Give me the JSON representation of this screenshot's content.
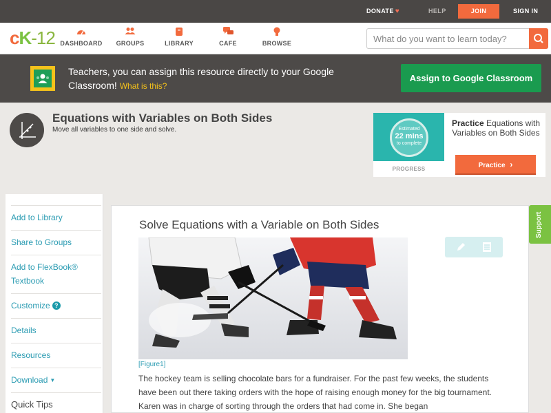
{
  "topbar": {
    "donate": "DONATE",
    "help": "HELP",
    "join": "JOIN",
    "signin": "SIGN IN"
  },
  "logo": {
    "c": "c",
    "k": "K",
    "n": "-12"
  },
  "nav": {
    "items": [
      {
        "label": "DASHBOARD",
        "icon": "gauge-icon"
      },
      {
        "label": "GROUPS",
        "icon": "people-icon"
      },
      {
        "label": "LIBRARY",
        "icon": "book-icon"
      },
      {
        "label": "CAFE",
        "icon": "chat-icon"
      },
      {
        "label": "BROWSE",
        "icon": "lightbulb-icon"
      }
    ]
  },
  "search": {
    "placeholder": "What do you want to learn today?"
  },
  "banner": {
    "text": "Teachers, you can assign this resource directly to your Google Classroom!",
    "whatis": "What is this?",
    "assign_button": "Assign to Google Classroom"
  },
  "concept": {
    "title": "Equations with Variables on Both Sides",
    "subtitle": "Move all variables to one side and solve."
  },
  "practice": {
    "estimated": "Estimated",
    "mins": "22 mins",
    "to_complete": "to complete",
    "progress": "PROGRESS",
    "practice_word": "Practice",
    "practice_topic": "Equations with Variables on Both Sides",
    "button": "Practice"
  },
  "sidebar": {
    "items": [
      {
        "label": "Add to Library"
      },
      {
        "label": "Share to Groups"
      },
      {
        "label": "Add to FlexBook® Textbook"
      },
      {
        "label": "Customize"
      },
      {
        "label": "Details"
      },
      {
        "label": "Resources"
      },
      {
        "label": "Download"
      },
      {
        "label": "Quick Tips"
      }
    ]
  },
  "content": {
    "title": "Solve Equations with a Variable on Both Sides",
    "caption": "[Figure1]",
    "body": "The hockey team is selling chocolate bars for a fundraiser. For the past few weeks, the students have been out there taking orders with the hope of raising enough money for the big tournament. Karen was in charge of sorting through the orders that had come in. She began"
  },
  "support": "Support",
  "colors": {
    "brand_orange": "#f26a3d",
    "brand_green": "#7bc242",
    "classroom_green": "#1a9b4f",
    "link_teal": "#2a9bb2",
    "dark_bar": "#4a4745"
  }
}
